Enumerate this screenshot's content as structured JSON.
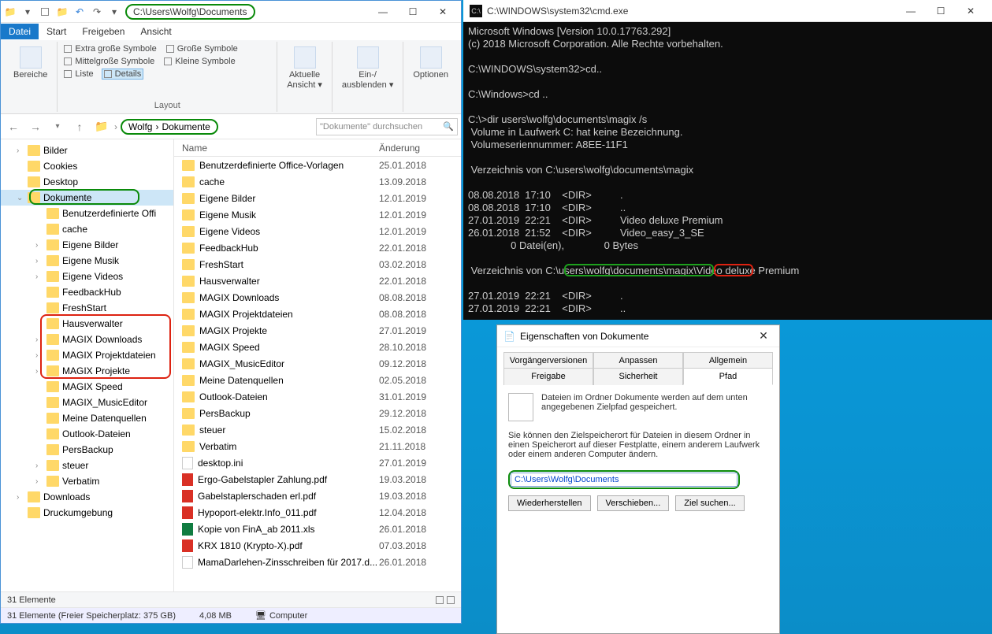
{
  "explorer": {
    "title_path": "C:\\Users\\Wolfg\\Documents",
    "tabs": {
      "datei": "Datei",
      "start": "Start",
      "freigeben": "Freigeben",
      "ansicht": "Ansicht"
    },
    "ribbon": {
      "bereiche": "Bereiche",
      "views": {
        "extra": "Extra große Symbole",
        "grosse": "Große Symbole",
        "mittel": "Mittelgroße Symbole",
        "kleine": "Kleine Symbole",
        "liste": "Liste",
        "details": "Details"
      },
      "layout": "Layout",
      "aktuelle": "Aktuelle\nAnsicht ▾",
      "einaus": "Ein-/\nausblenden ▾",
      "optionen": "Optionen"
    },
    "breadcrumb": {
      "p1": "Wolfg",
      "p2": "Dokumente"
    },
    "search_placeholder": "\"Dokumente\" durchsuchen",
    "tree": [
      {
        "label": "Bilder",
        "lvl": 1,
        "chev": ">",
        "ico": "img"
      },
      {
        "label": "Cookies",
        "lvl": 1,
        "chev": "",
        "ico": "f"
      },
      {
        "label": "Desktop",
        "lvl": 1,
        "chev": "",
        "ico": "desk"
      },
      {
        "label": "Dokumente",
        "lvl": 1,
        "chev": "v",
        "sel": true,
        "ico": "doc"
      },
      {
        "label": "Benutzerdefinierte Offi",
        "lvl": 2
      },
      {
        "label": "cache",
        "lvl": 2
      },
      {
        "label": "Eigene Bilder",
        "lvl": 2,
        "chev": ">"
      },
      {
        "label": "Eigene Musik",
        "lvl": 2,
        "chev": ">"
      },
      {
        "label": "Eigene Videos",
        "lvl": 2,
        "chev": ">"
      },
      {
        "label": "FeedbackHub",
        "lvl": 2
      },
      {
        "label": "FreshStart",
        "lvl": 2
      },
      {
        "label": "Hausverwalter",
        "lvl": 2
      },
      {
        "label": "MAGIX Downloads",
        "lvl": 2,
        "chev": ">"
      },
      {
        "label": "MAGIX Projektdateien",
        "lvl": 2,
        "chev": ">"
      },
      {
        "label": "MAGIX Projekte",
        "lvl": 2,
        "chev": ">"
      },
      {
        "label": "MAGIX Speed",
        "lvl": 2
      },
      {
        "label": "MAGIX_MusicEditor",
        "lvl": 2
      },
      {
        "label": "Meine Datenquellen",
        "lvl": 2,
        "ico": "dq"
      },
      {
        "label": "Outlook-Dateien",
        "lvl": 2
      },
      {
        "label": "PersBackup",
        "lvl": 2
      },
      {
        "label": "steuer",
        "lvl": 2,
        "chev": ">"
      },
      {
        "label": "Verbatim",
        "lvl": 2,
        "chev": ">"
      },
      {
        "label": "Downloads",
        "lvl": 1,
        "chev": ">",
        "ico": "dl"
      },
      {
        "label": "Druckumgebung",
        "lvl": 1,
        "ico": "prn"
      }
    ],
    "cols": {
      "name": "Name",
      "date": "Änderung"
    },
    "files": [
      {
        "n": "Benutzerdefinierte Office-Vorlagen",
        "d": "25.01.2018",
        "t": "folder"
      },
      {
        "n": "cache",
        "d": "13.09.2018",
        "t": "folder"
      },
      {
        "n": "Eigene Bilder",
        "d": "12.01.2019",
        "t": "link"
      },
      {
        "n": "Eigene Musik",
        "d": "12.01.2019",
        "t": "link"
      },
      {
        "n": "Eigene Videos",
        "d": "12.01.2019",
        "t": "link"
      },
      {
        "n": "FeedbackHub",
        "d": "22.01.2018",
        "t": "folder"
      },
      {
        "n": "FreshStart",
        "d": "03.02.2018",
        "t": "folder"
      },
      {
        "n": "Hausverwalter",
        "d": "22.01.2018",
        "t": "folder"
      },
      {
        "n": "MAGIX Downloads",
        "d": "08.08.2018",
        "t": "folder"
      },
      {
        "n": "MAGIX Projektdateien",
        "d": "08.08.2018",
        "t": "folder"
      },
      {
        "n": "MAGIX Projekte",
        "d": "27.01.2019",
        "t": "folder"
      },
      {
        "n": "MAGIX Speed",
        "d": "28.10.2018",
        "t": "folder"
      },
      {
        "n": "MAGIX_MusicEditor",
        "d": "09.12.2018",
        "t": "folder"
      },
      {
        "n": "Meine Datenquellen",
        "d": "02.05.2018",
        "t": "dq"
      },
      {
        "n": "Outlook-Dateien",
        "d": "31.01.2019",
        "t": "folder"
      },
      {
        "n": "PersBackup",
        "d": "29.12.2018",
        "t": "folder"
      },
      {
        "n": "steuer",
        "d": "15.02.2018",
        "t": "folder"
      },
      {
        "n": "Verbatim",
        "d": "21.11.2018",
        "t": "folder"
      },
      {
        "n": "desktop.ini",
        "d": "27.01.2019",
        "t": "file"
      },
      {
        "n": "Ergo-Gabelstapler Zahlung.pdf",
        "d": "19.03.2018",
        "t": "pdf"
      },
      {
        "n": "Gabelstaplerschaden erl.pdf",
        "d": "19.03.2018",
        "t": "pdf"
      },
      {
        "n": "Hypoport-elektr.Info_011.pdf",
        "d": "12.04.2018",
        "t": "pdf"
      },
      {
        "n": "Kopie von FinA_ab 2011.xls",
        "d": "26.01.2018",
        "t": "xls"
      },
      {
        "n": "KRX 1810 (Krypto-X).pdf",
        "d": "07.03.2018",
        "t": "pdf"
      },
      {
        "n": "MamaDarlehen-Zinsschreiben für 2017.d...",
        "d": "26.01.2018",
        "t": "file"
      }
    ],
    "status": "31 Elemente",
    "status2": {
      "a": "31 Elemente (Freier Speicherplatz: 375 GB)",
      "b": "4,08 MB",
      "c": "Computer"
    }
  },
  "cmd": {
    "title": "C:\\WINDOWS\\system32\\cmd.exe",
    "lines": [
      "Microsoft Windows [Version 10.0.17763.292]",
      "(c) 2018 Microsoft Corporation. Alle Rechte vorbehalten.",
      "",
      "C:\\WINDOWS\\system32>cd..",
      "",
      "C:\\Windows>cd ..",
      "",
      "C:\\>dir users\\wolfg\\documents\\magix /s",
      " Volume in Laufwerk C: hat keine Bezeichnung.",
      " Volumeseriennummer: A8EE-11F1",
      "",
      " Verzeichnis von C:\\users\\wolfg\\documents\\magix",
      "",
      "08.08.2018  17:10    <DIR>          .",
      "08.08.2018  17:10    <DIR>          ..",
      "27.01.2019  22:21    <DIR>          Video deluxe Premium",
      "26.01.2018  21:52    <DIR>          Video_easy_3_SE",
      "               0 Datei(en),              0 Bytes",
      "",
      " Verzeichnis von C:\\users\\wolfg\\documents\\magix\\Video deluxe Premium",
      "",
      "27.01.2019  22:21    <DIR>          .",
      "27.01.2019  22:21    <DIR>          .."
    ]
  },
  "props": {
    "title": "Eigenschaften von Dokumente",
    "tabs": {
      "vor": "Vorgängerversionen",
      "anp": "Anpassen",
      "allg": "Allgemein",
      "frei": "Freigabe",
      "sich": "Sicherheit",
      "pfad": "Pfad"
    },
    "desc1": "Dateien im Ordner Dokumente werden auf dem unten angegebenen Zielpfad gespeichert.",
    "desc2": "Sie können den Zielspeicherort für Dateien in diesem Ordner in einen Speicherort auf dieser Festplatte, einem anderem Laufwerk oder einem anderen Computer ändern.",
    "path": "C:\\Users\\Wolfg\\Documents",
    "btns": {
      "wie": "Wiederherstellen",
      "ver": "Verschieben...",
      "ziel": "Ziel suchen..."
    }
  }
}
